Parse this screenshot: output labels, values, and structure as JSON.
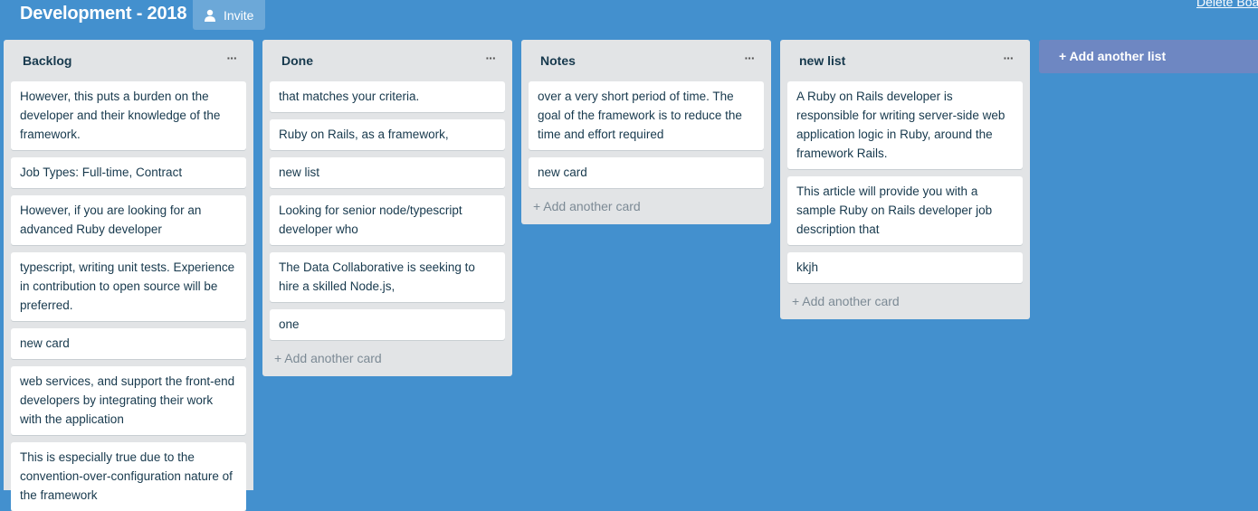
{
  "board": {
    "title": "Development - 2018",
    "invite_label": "Invite",
    "delete_label": "Delete Board"
  },
  "lists": [
    {
      "title": "Backlog",
      "menu": "···",
      "cards": [
        "However, this puts a burden on the developer and their knowledge of the framework.",
        "Job Types: Full-time, Contract",
        "However, if you are looking for an advanced Ruby developer",
        "typescript, writing unit tests. Experience in contribution to open source will be preferred.",
        "new card",
        "web services, and support the front-end developers by integrating their work with the application",
        "This is especially true due to the convention-over-configuration nature of the framework"
      ]
    },
    {
      "title": "Done",
      "menu": "···",
      "cards": [
        "that matches your criteria.",
        "Ruby on Rails, as a framework,",
        "new list",
        "Looking for senior node/typescript developer who",
        "The Data Collaborative is seeking to hire a skilled Node.js,",
        "one"
      ],
      "add_card": "+ Add another card"
    },
    {
      "title": "Notes",
      "menu": "···",
      "cards": [
        "over a very short period of time. The goal of the framework is to reduce the time and effort required",
        "new card"
      ],
      "add_card": "+ Add another card"
    },
    {
      "title": "new list",
      "menu": "···",
      "cards": [
        "A Ruby on Rails developer is responsible for writing server-side web application logic in Ruby, around the framework Rails.",
        "This article will provide you with a sample Ruby on Rails developer job description that",
        "kkjh"
      ],
      "add_card": "+ Add another card"
    }
  ],
  "add_list_label": "+ Add another list",
  "colors": {
    "background": "#4390ce",
    "list_background": "#e2e4e6",
    "add_list": "#6e87c2"
  },
  "icons": {
    "invite": "person-icon",
    "list_menu": "ellipsis-icon"
  }
}
